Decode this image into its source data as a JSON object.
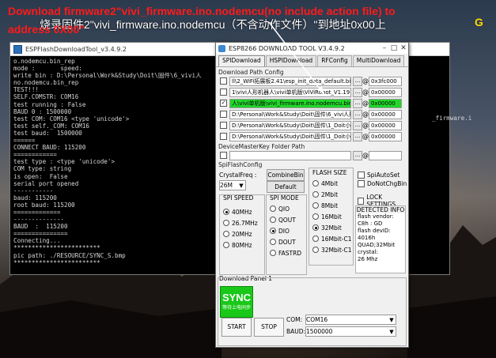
{
  "caption": {
    "line1": "Download firmware2\"vivi_firmware.ino.nodemcu(no include action file) to",
    "line2": "address 0X00\"",
    "chinese": "烧录固件2\"vivi_firmware.ino.nodemcu（不含动作文件）\"到地址0x00上",
    "g": "G"
  },
  "console": {
    "title": "ESPFlashDownloadTool_v3.4.9.2",
    "lines": [
      "o.nodemcu.bin_rep",
      "mode :       speed:",
      "write bin : D:\\Personal\\Work&Study\\Doit\\固件\\6_vivi人",
      "no.nodemcu.bin_rep",
      "TEST!!!",
      "SELF.COMSTR: COM16",
      "test running : False",
      "BAUD 0 : 1500000",
      "test COM: COM16 <type 'unicode'>",
      "test self._COM: COM16",
      "test baud:  1500000",
      "======",
      "CONNECT BAUD: 115200",
      "============",
      "test type : <type 'unicode'>",
      "COM type: string",
      "is open:  False",
      "serial port opened",
      "-----------",
      "baud: 115200",
      "root baud: 115200",
      "=============",
      "--------------",
      "BAUD  :  115200",
      "===============",
      "Connecting...",
      "************************",
      "pic path: ./RESOURCE/SYNC_S.bmp",
      "************************"
    ],
    "tail_text": "_firmware.i"
  },
  "esp": {
    "title": "ESP8266 DOWNLOAD TOOL V3.4.9.2",
    "tabs": [
      "SPIDownload",
      "HSPIDownload",
      "RFConfig",
      "MultiDownload"
    ],
    "path_group_label": "Download Path Config",
    "paths": [
      {
        "checked": false,
        "path": "ll\\2_WiFi拓展板2.41\\esp_init_data_default.bin",
        "addr": "0x3fc000",
        "highlight": false
      },
      {
        "checked": false,
        "path": "1\\vivi人形机器人\\vivi单机版\\ViViRobot_V1.19.bin",
        "addr": "0x00000",
        "highlight": false
      },
      {
        "checked": true,
        "path": "人\\vivi单机版\\vivi_firmware.ino.nodemcu.bin",
        "addr": "0x00000",
        "highlight": true
      },
      {
        "checked": false,
        "path": "D:\\Personal\\Work&Study\\Doit\\固件\\6_vivi人形",
        "addr": "0x00000",
        "highlight": false
      },
      {
        "checked": false,
        "path": "D:\\Personal\\Work&Study\\Doit\\固件\\1_Doit小",
        "addr": "0x00000",
        "highlight": false
      },
      {
        "checked": false,
        "path": "D:\\Personal\\Work&Study\\Doit\\固件\\1_Doit小",
        "addr": "0x00000",
        "highlight": false
      }
    ],
    "master_key_label": "DeviceMasterKey Folder Path",
    "spi_flash_config": "SpiFlashConfig",
    "crystal_label": "CrystalFreq :",
    "crystal_value": "26M",
    "combine_bin": "CombineBin",
    "default_btn": "Default",
    "flash_size_label": "FLASH SIZE",
    "flash_sizes": [
      {
        "label": "4Mbit",
        "on": false
      },
      {
        "label": "2Mbit",
        "on": false
      },
      {
        "label": "8Mbit",
        "on": false
      },
      {
        "label": "16Mbit",
        "on": false
      },
      {
        "label": "32Mbit",
        "on": true
      },
      {
        "label": "16Mbit-C1",
        "on": false
      },
      {
        "label": "32Mbit-C1",
        "on": false
      }
    ],
    "spi_auto_set": "SpiAutoSet",
    "do_not_chg_bin": "DoNotChgBin",
    "lock_settings": "LOCK SETTINGS",
    "detected_info_label": "DETECTED INFO",
    "detected_info": [
      "flash vendor:",
      "C8h : GD",
      "flash devID:",
      "4016h",
      "QUAD;32Mbit",
      "crystal:",
      "26 Mhz"
    ],
    "spi_speed_label": "SPI SPEED",
    "spi_speeds": [
      {
        "label": "40MHz",
        "on": true
      },
      {
        "label": "26.7MHz",
        "on": false
      },
      {
        "label": "20MHz",
        "on": false
      },
      {
        "label": "80MHz",
        "on": false
      }
    ],
    "spi_mode_label": "SPI MODE",
    "spi_modes": [
      {
        "label": "QIO",
        "on": false
      },
      {
        "label": "QOUT",
        "on": false
      },
      {
        "label": "DIO",
        "on": true
      },
      {
        "label": "DOUT",
        "on": false
      },
      {
        "label": "FASTRD",
        "on": false
      }
    ],
    "download_panel_label": "Download Panel 1",
    "sync_label": "SYNC",
    "sync_sub": "等待上电同步",
    "start": "START",
    "stop": "STOP",
    "com_label": "COM:",
    "com_value": "COM16",
    "baud_label": "BAUD:",
    "baud_value": "1500000"
  },
  "colors": {
    "caption_red": "#ff1a1a",
    "highlight_green": "#23d52b",
    "sync_green": "#19c819"
  }
}
